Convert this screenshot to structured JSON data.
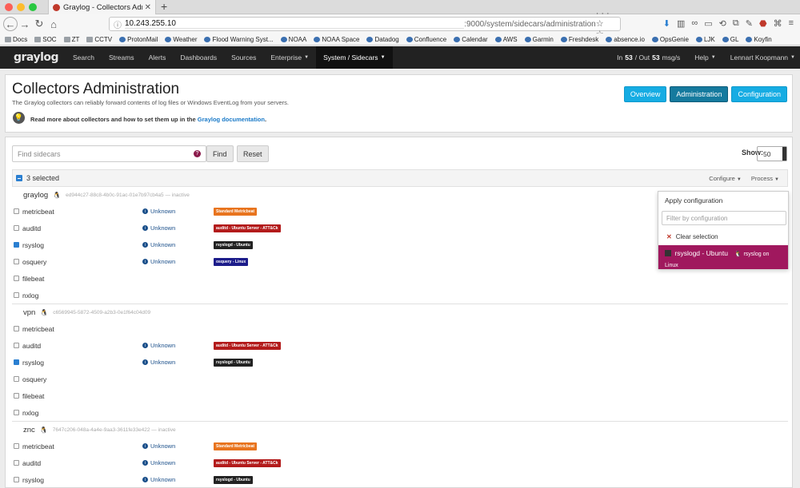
{
  "browser": {
    "tab_title": "Graylog - Collectors Administrati",
    "url_host": "10.243.255.10",
    "url_path": ":9000/system/sidecars/administration",
    "url_right": "··· ☆ ☆",
    "bookmarks": [
      "Docs",
      "SOC",
      "ZT",
      "CCTV",
      "ProtonMail",
      "Weather",
      "Flood Warning Syst...",
      "NOAA",
      "NOAA Space",
      "Datadog",
      "Confluence",
      "Calendar",
      "AWS",
      "Garmin",
      "Freshdesk",
      "absence.io",
      "OpsGenie",
      "LJK",
      "GL",
      "Koyfin"
    ]
  },
  "nav": {
    "logo": "graylog",
    "items": [
      "Search",
      "Streams",
      "Alerts",
      "Dashboards",
      "Sources",
      "Enterprise",
      "System / Sidecars"
    ],
    "throughput_prefix": "In ",
    "in_count": "53",
    "throughput_mid": " / Out ",
    "out_count": "53",
    "throughput_suffix": " msg/s",
    "help": "Help",
    "user": "Lennart Koopmann"
  },
  "header": {
    "title": "Collectors Administration",
    "description": "The Graylog collectors can reliably forward contents of log files or Windows EventLog from your servers.",
    "doc_text": "Read more about collectors and how to set them up in the ",
    "doc_link": "Graylog documentation",
    "doc_end": ".",
    "buttons": [
      "Overview",
      "Administration",
      "Configuration"
    ]
  },
  "toolbar": {
    "search_placeholder": "Find sidecars",
    "find": "Find",
    "reset": "Reset",
    "show_label": "Show:",
    "show_value": "50",
    "selected": "3 selected",
    "configure": "Configure",
    "process": "Process"
  },
  "dropdown": {
    "header": "Apply configuration",
    "filter_placeholder": "Filter by configuration",
    "clear": "Clear selection",
    "selected_name": "rsyslogd - Ubuntu",
    "selected_collector": "rsyslog on",
    "selected_os": "Linux"
  },
  "status_text": "Unknown",
  "colors": {
    "metricbeat": "#e8741e",
    "auditd": "#b31b1b",
    "rsyslog": "#222222",
    "osquery": "#1c1c8a"
  },
  "sidecars": [
    {
      "name": "graylog",
      "node_id": "ed944c27-88c8-4b0c-91ac-01e7b97cb4a5 — inactive",
      "collectors": [
        {
          "name": "metricbeat",
          "checked": false,
          "status": "Unknown",
          "tag": "Standard Metricbeat",
          "tag_color": "metricbeat"
        },
        {
          "name": "auditd",
          "checked": false,
          "status": "Unknown",
          "tag": "auditd - Ubuntu Server - ATT&Ck",
          "tag_color": "auditd"
        },
        {
          "name": "rsyslog",
          "checked": true,
          "status": "Unknown",
          "tag": "rsyslogd - Ubuntu",
          "tag_color": "rsyslog"
        },
        {
          "name": "osquery",
          "checked": false,
          "status": "Unknown",
          "tag": "osquery - Linux",
          "tag_color": "osquery"
        },
        {
          "name": "filebeat",
          "checked": false,
          "status": "",
          "tag": "",
          "tag_color": ""
        },
        {
          "name": "nxlog",
          "checked": false,
          "status": "",
          "tag": "",
          "tag_color": ""
        }
      ]
    },
    {
      "name": "vpn",
      "node_id": "c6569945-5872-4509-a2b3-0e1f64c04d09",
      "collectors": [
        {
          "name": "metricbeat",
          "checked": false,
          "status": "",
          "tag": "",
          "tag_color": ""
        },
        {
          "name": "auditd",
          "checked": false,
          "status": "Unknown",
          "tag": "auditd - Ubuntu Server - ATT&Ck",
          "tag_color": "auditd"
        },
        {
          "name": "rsyslog",
          "checked": true,
          "status": "Unknown",
          "tag": "rsyslogd - Ubuntu",
          "tag_color": "rsyslog"
        },
        {
          "name": "osquery",
          "checked": false,
          "status": "",
          "tag": "",
          "tag_color": ""
        },
        {
          "name": "filebeat",
          "checked": false,
          "status": "",
          "tag": "",
          "tag_color": ""
        },
        {
          "name": "nxlog",
          "checked": false,
          "status": "",
          "tag": "",
          "tag_color": ""
        }
      ]
    },
    {
      "name": "znc",
      "node_id": "7647c206-048a-4a4e-9aa3-3611fe33e422 — inactive",
      "collectors": [
        {
          "name": "metricbeat",
          "checked": false,
          "status": "Unknown",
          "tag": "Standard Metricbeat",
          "tag_color": "metricbeat"
        },
        {
          "name": "auditd",
          "checked": false,
          "status": "Unknown",
          "tag": "auditd - Ubuntu Server - ATT&Ck",
          "tag_color": "auditd"
        },
        {
          "name": "rsyslog",
          "checked": false,
          "status": "Unknown",
          "tag": "rsyslogd - Ubuntu",
          "tag_color": "rsyslog"
        }
      ]
    }
  ]
}
